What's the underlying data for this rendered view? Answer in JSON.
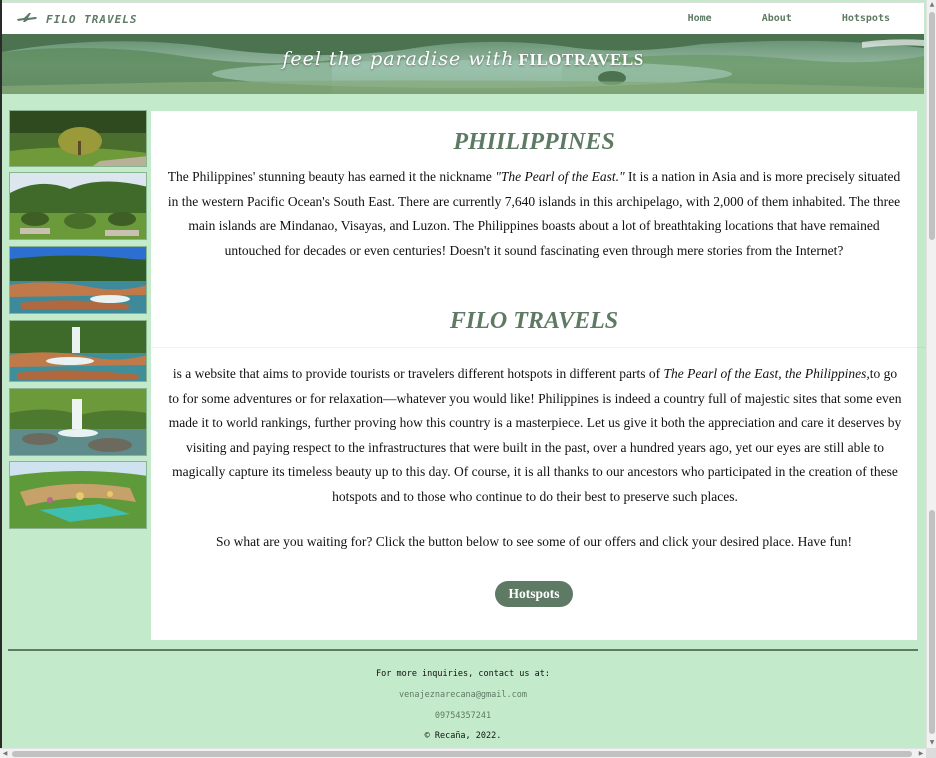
{
  "colors": {
    "accent": "#5e7a64",
    "page_bg": "#c3eaca",
    "card_bg": "#ffffff"
  },
  "nav": {
    "brand": "FILO TRAVELS",
    "brand_icon": "plane-icon",
    "links": [
      "Home",
      "About",
      "Hotspots"
    ]
  },
  "banner": {
    "script_text": "feel the paradise with",
    "bold_text": "FILOTRAVELS"
  },
  "main": {
    "heading1": "PHIILIPPINES",
    "para1_a": "The Philippines' stunning beauty has earned it the nickname ",
    "para1_em": "\"The Pearl of the East.\"",
    "para1_b": " It is a nation in Asia and is more precisely situated in the western Pacific Ocean's South East. There are currently 7,640 islands in this archipelago, with 2,000 of them inhabited. The three main islands are Mindanao, Visayas, and Luzon. The Philippines boasts about a lot of breathtaking locations that have remained untouched for decades or even centuries! Doesn't it sound fascinating even through mere stories from the Internet?",
    "heading2": "FILO TRAVELS",
    "para2_a": "is a website that aims to provide tourists or travelers different hotspots in different parts of ",
    "para2_em": "The Pearl of the East, the Philippines,",
    "para2_b": "to go to for some adventures or for relaxation—whatever you would like! Philippines is indeed a country full of majestic sites that some even made it to world rankings, further proving how this country is a masterpiece. Let us give it both the appreciation and care it deserves by visiting and paying respect to the infrastructures that were built in the past, over a hundred years ago, yet our eyes are still able to magically capture its timeless beauty up to this day. Of course, it is all thanks to our ancestors who participated in the creation of these hotspots and to those who continue to do their best to preserve such places.",
    "para3": "So what are you waiting for? Click the button below to see some of our offers and click your desired place. Have fun!",
    "button": "Hotspots"
  },
  "footer": {
    "heading": "For more inquiries, contact us at:",
    "email": "venajeznarecana@gmail.com",
    "phone": "09754357241",
    "copyright": "© Recaña, 2022."
  }
}
